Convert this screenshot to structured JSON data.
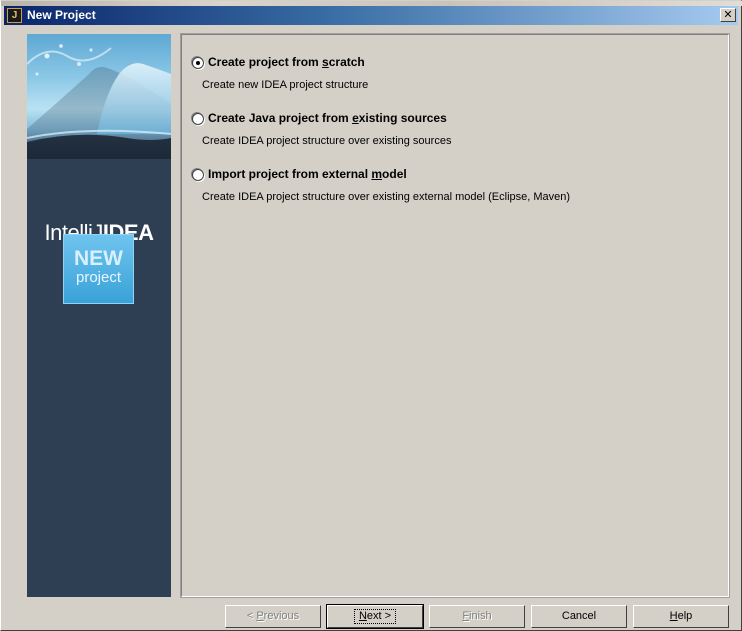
{
  "window": {
    "title": "New Project",
    "close_glyph": "✕",
    "icon": "intellij-app-icon"
  },
  "sidebar": {
    "brand_light": "IntelliJ",
    "brand_bold": "IDEA",
    "badge_line1": "NEW",
    "badge_line2": "project"
  },
  "options": [
    {
      "label_pre": "Create project from ",
      "label_mnemonic": "s",
      "label_post": "cratch",
      "description": "Create new IDEA project structure",
      "selected": true
    },
    {
      "label_pre": "Create Java project from ",
      "label_mnemonic": "e",
      "label_post": "xisting sources",
      "description": "Create IDEA project structure over existing sources",
      "selected": false
    },
    {
      "label_pre": "Import project from external ",
      "label_mnemonic": "m",
      "label_post": "odel",
      "description": "Create IDEA project structure over existing external model (Eclipse, Maven)",
      "selected": false
    }
  ],
  "buttons": {
    "previous": {
      "pre": "< ",
      "mnemonic": "P",
      "post": "revious"
    },
    "next": {
      "pre": "",
      "mnemonic": "N",
      "post": "ext >"
    },
    "finish": {
      "pre": "",
      "mnemonic": "F",
      "post": "inish"
    },
    "cancel": {
      "label": "Cancel"
    },
    "help": {
      "pre": "",
      "mnemonic": "H",
      "post": "elp"
    }
  },
  "colors": {
    "titlebar_start": "#0a246a",
    "titlebar_end": "#a6caf0",
    "sidebar_bg": "#2e3e53",
    "badge_bg": "#3aa2d8"
  }
}
